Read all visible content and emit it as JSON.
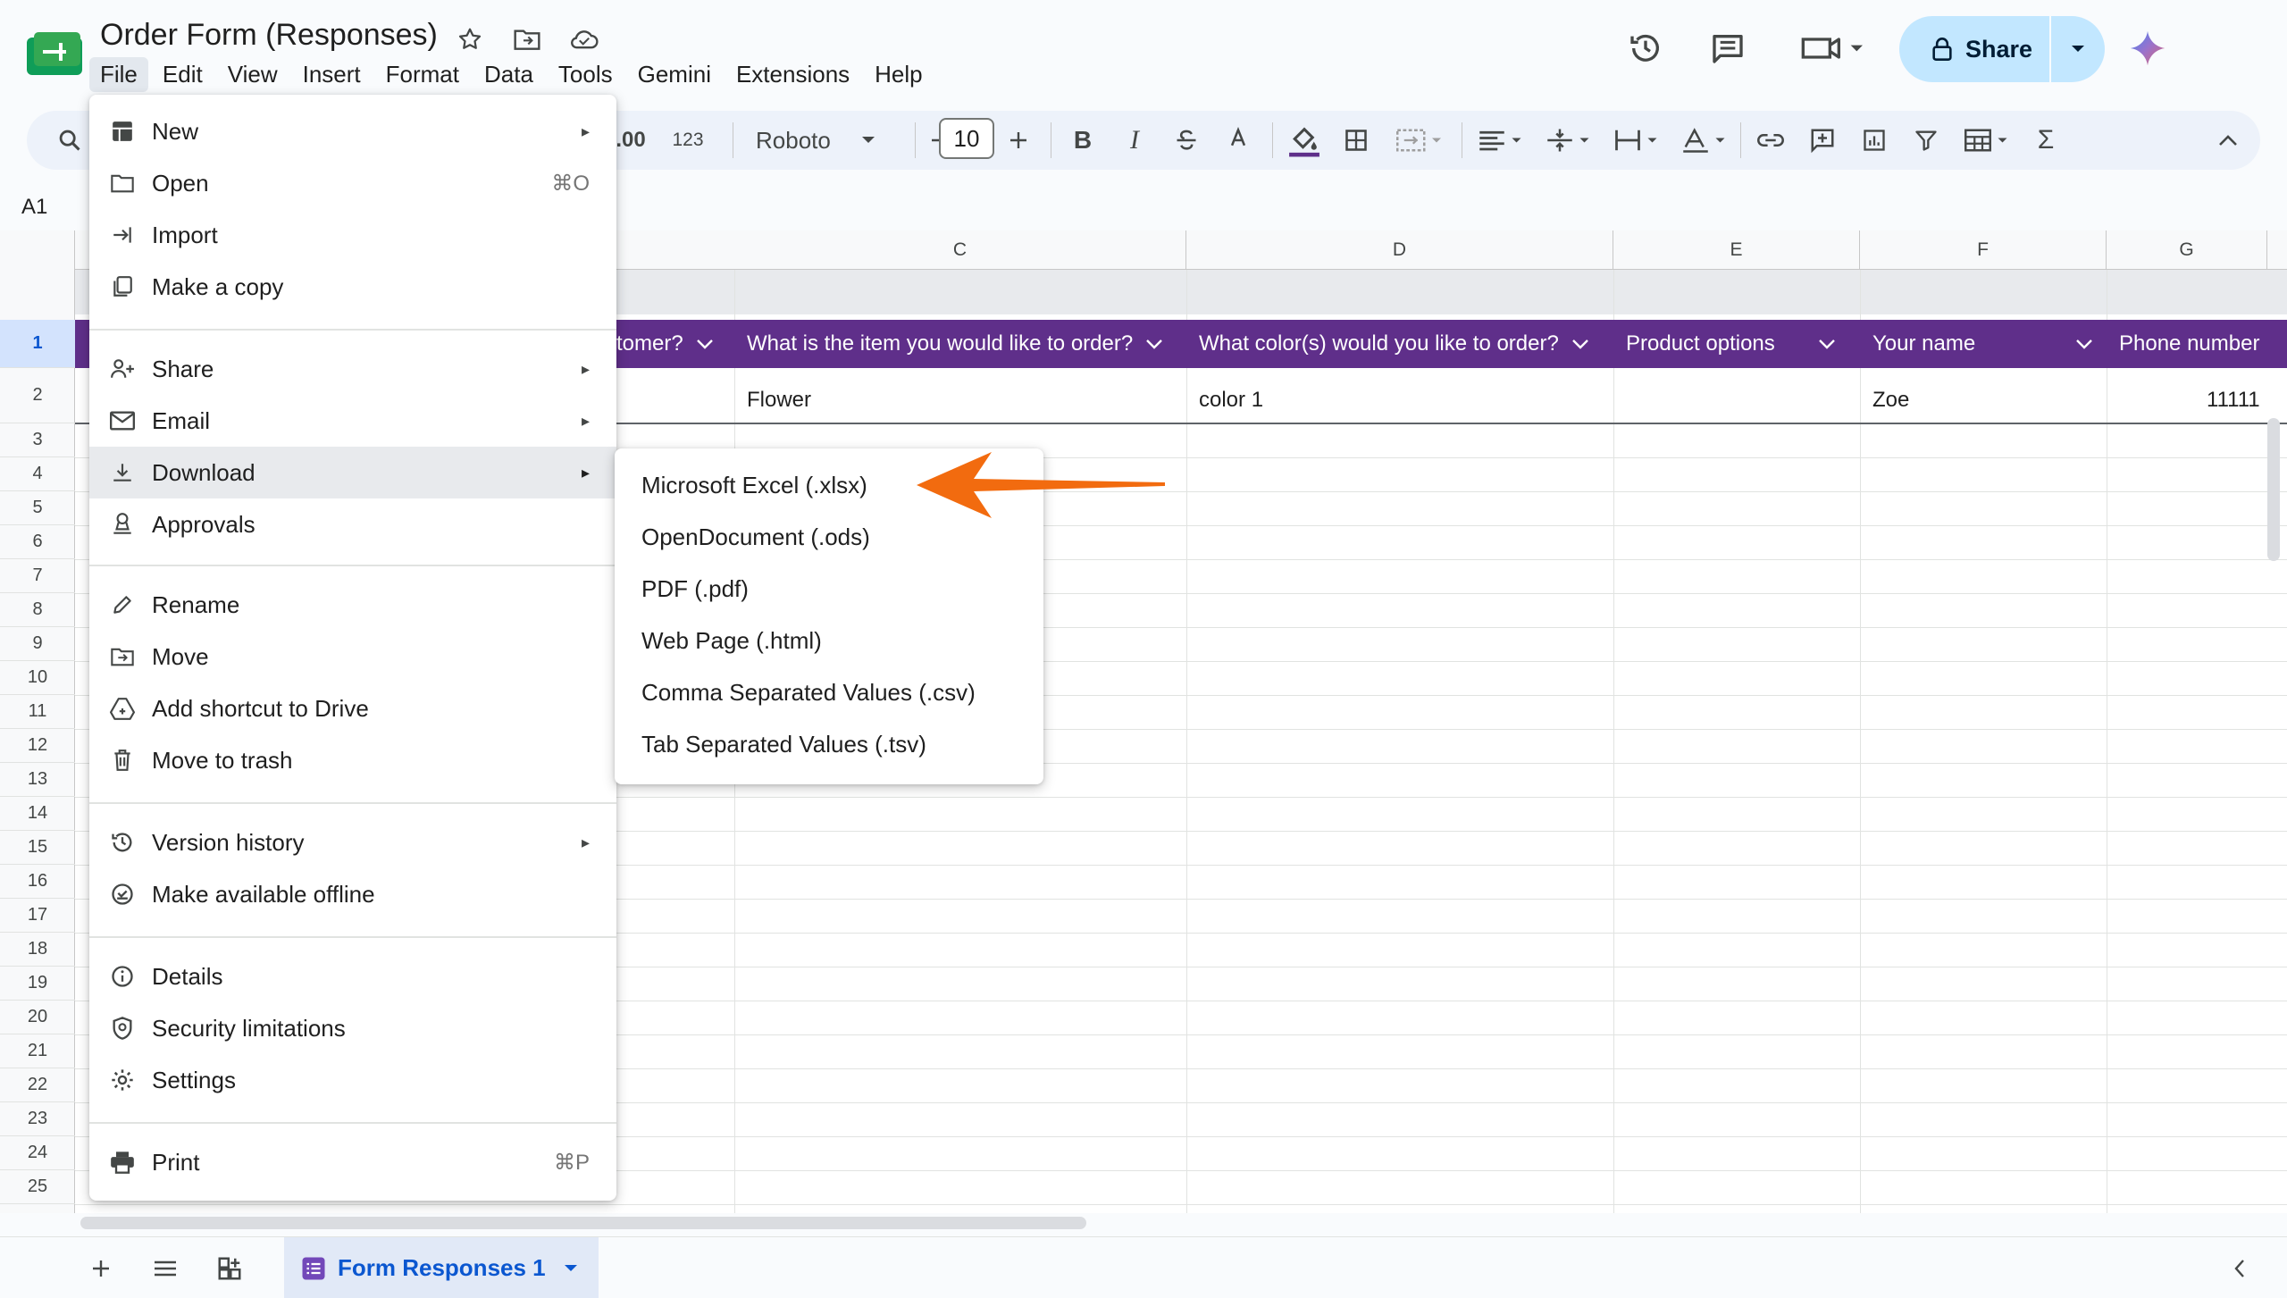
{
  "app": {
    "title": "Order Form (Responses)",
    "menus": [
      "File",
      "Edit",
      "View",
      "Insert",
      "Format",
      "Data",
      "Tools",
      "Gemini",
      "Extensions",
      "Help"
    ]
  },
  "header": {
    "share_label": "Share"
  },
  "toolbar": {
    "decimal_label": ".00",
    "format_label": "123",
    "font_name": "Roboto",
    "font_size": "10"
  },
  "formula_bar": {
    "cell_ref": "A1"
  },
  "grid": {
    "columns": [
      "C",
      "D",
      "E",
      "F",
      "G"
    ],
    "rows": [
      "1",
      "2",
      "3",
      "4",
      "5",
      "6",
      "7",
      "8",
      "9",
      "10",
      "11",
      "12",
      "13",
      "14",
      "15",
      "16",
      "17",
      "18",
      "19",
      "20",
      "21",
      "22",
      "23",
      "24",
      "25"
    ],
    "header_cells": [
      "tomer?",
      "What is the item you would like to order?",
      "What color(s) would you like to order?",
      "Product options",
      "Your name",
      "Phone number"
    ],
    "row2": {
      "item": "Flower",
      "color": "color 1",
      "name": "Zoe",
      "phone": "11111"
    }
  },
  "file_menu": {
    "items": [
      {
        "label": "New",
        "icon": "new-icon",
        "arrow": "▸"
      },
      {
        "label": "Open",
        "icon": "folder-icon",
        "shortcut": "⌘O"
      },
      {
        "label": "Import",
        "icon": "import-icon"
      },
      {
        "label": "Make a copy",
        "icon": "copy-icon"
      },
      {
        "label": "Share",
        "icon": "share-person-icon",
        "arrow": "▸"
      },
      {
        "label": "Email",
        "icon": "email-icon",
        "arrow": "▸"
      },
      {
        "label": "Download",
        "icon": "download-icon",
        "arrow": "▸"
      },
      {
        "label": "Approvals",
        "icon": "approvals-icon"
      },
      {
        "label": "Rename",
        "icon": "pencil-icon"
      },
      {
        "label": "Move",
        "icon": "move-folder-icon"
      },
      {
        "label": "Add shortcut to Drive",
        "icon": "drive-shortcut-icon"
      },
      {
        "label": "Move to trash",
        "icon": "trash-icon"
      },
      {
        "label": "Version history",
        "icon": "history-icon",
        "arrow": "▸"
      },
      {
        "label": "Make available offline",
        "icon": "offline-icon"
      },
      {
        "label": "Details",
        "icon": "info-icon"
      },
      {
        "label": "Security limitations",
        "icon": "security-icon"
      },
      {
        "label": "Settings",
        "icon": "gear-icon"
      },
      {
        "label": "Print",
        "icon": "print-icon",
        "shortcut": "⌘P"
      }
    ]
  },
  "download_submenu": {
    "items": [
      "Microsoft Excel (.xlsx)",
      "OpenDocument (.ods)",
      "PDF (.pdf)",
      "Web Page (.html)",
      "Comma Separated Values (.csv)",
      "Tab Separated Values (.tsv)"
    ]
  },
  "sheets": {
    "active_tab": "Form Responses 1"
  },
  "colors": {
    "accent": "#0b57d0",
    "header_purple": "#5f2f8a",
    "share_bg": "#c2e7ff",
    "annotation_arrow": "#f26b0f"
  }
}
